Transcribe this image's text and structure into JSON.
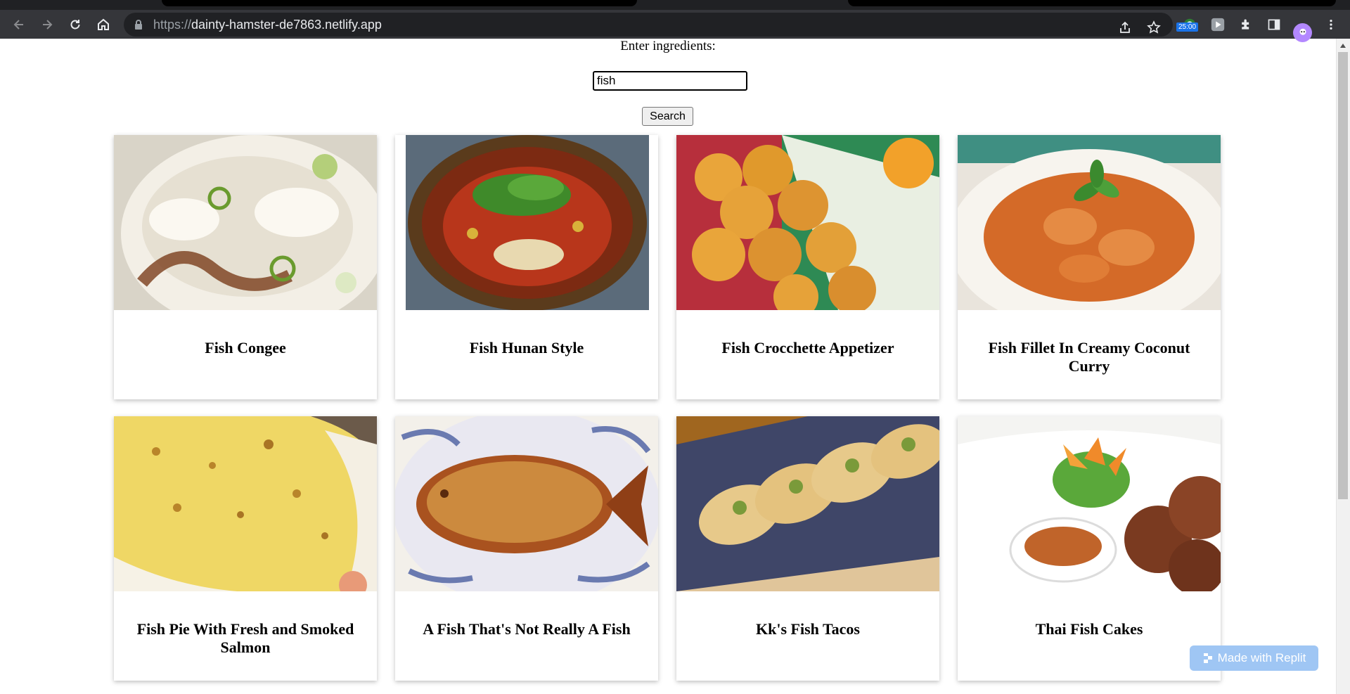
{
  "browser": {
    "url_scheme": "https://",
    "url_host": "dainty-hamster-de7863.netlify.app",
    "timer_badge": "25:00"
  },
  "page": {
    "label": "Enter ingredients:",
    "search_value": "fish",
    "search_button": "Search"
  },
  "recipes": [
    {
      "title": "Fish Congee",
      "icon": "photo-congee"
    },
    {
      "title": "Fish Hunan Style",
      "icon": "photo-hunan"
    },
    {
      "title": "Fish Crocchette Appetizer",
      "icon": "photo-crocchette"
    },
    {
      "title": "Fish Fillet In Creamy Coconut Curry",
      "icon": "photo-curry"
    },
    {
      "title": "Fish Pie With Fresh and Smoked Salmon",
      "icon": "photo-fish-pie"
    },
    {
      "title": "A Fish That's Not Really A Fish",
      "icon": "photo-fish-shaped-pie"
    },
    {
      "title": "Kk's Fish Tacos",
      "icon": "photo-tacos"
    },
    {
      "title": "Thai Fish Cakes",
      "icon": "photo-fish-cakes"
    }
  ],
  "replit_badge": "Made with Replit",
  "colors": {
    "toolbar": "#35363a",
    "omnibox": "#202124",
    "replit": "#9fc6f4"
  }
}
